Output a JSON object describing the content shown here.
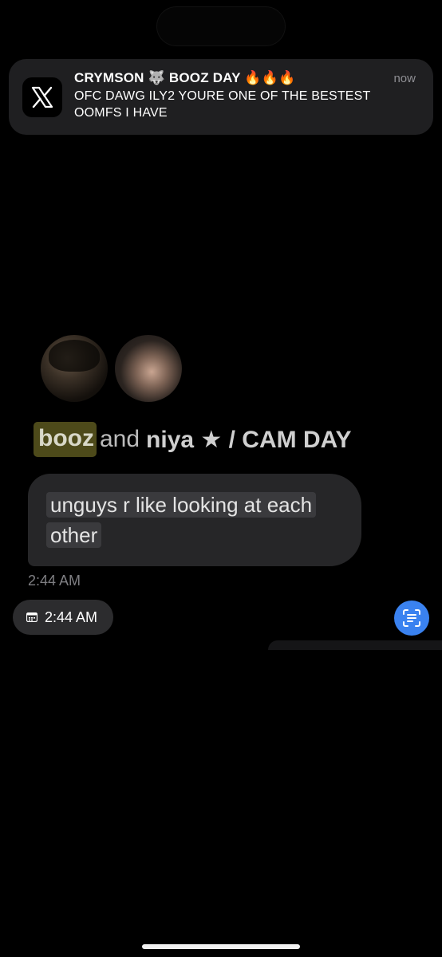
{
  "notification": {
    "app_icon": "x-logo-icon",
    "title": "CRYMSON 🐺 BOOZ DAY 🔥🔥🔥",
    "time": "now",
    "body": "OFC DAWG ILY2 YOURE ONE OF THE BESTEST OOMFS I HAVE"
  },
  "chat": {
    "name_highlighted": "booz",
    "name_and": "and",
    "name_rest": "niya ★ / CAM DAY",
    "message": "unguys r like looking at each other",
    "message_time": "2:44 AM",
    "time_chip": "2:44 AM"
  },
  "icons": {
    "calendar": "calendar-icon",
    "scan": "text-scan-icon"
  },
  "colors": {
    "background": "#000000",
    "banner": "#1f1f21",
    "bubble": "#262628",
    "highlight": "#4d4a1a",
    "scan_button": "#3a82f0"
  }
}
